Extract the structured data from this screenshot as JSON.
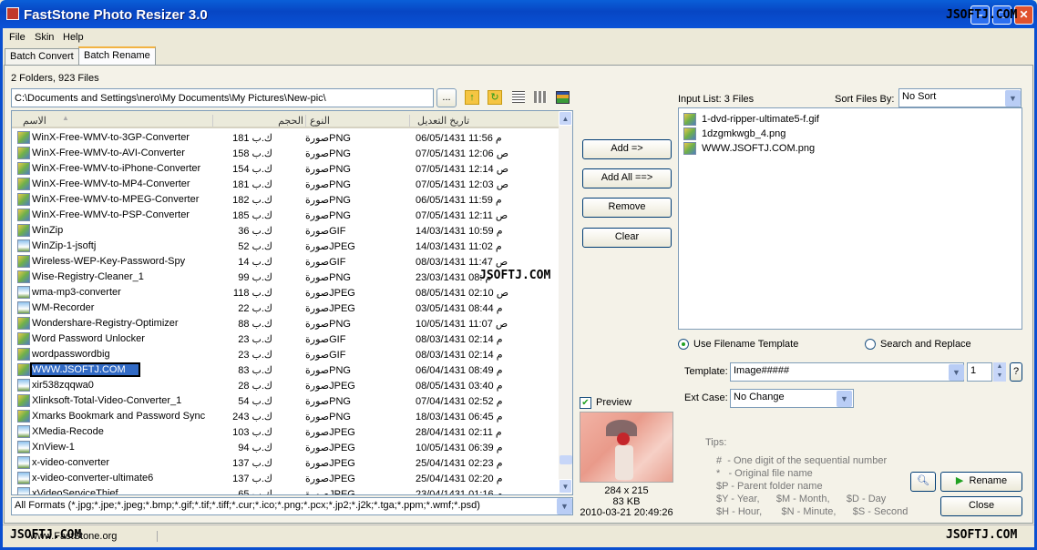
{
  "window": {
    "title": "FastStone Photo Resizer 3.0",
    "watermark": "JSOFTJ.COM",
    "minimize": "–",
    "maximize": "□",
    "close": "✕"
  },
  "menu": [
    "File",
    "Skin",
    "Help"
  ],
  "tabs": [
    {
      "label": "Batch Convert",
      "active": false
    },
    {
      "label": "Batch Rename",
      "active": true
    }
  ],
  "browser": {
    "summary": "2 Folders, 923 Files",
    "path": "C:\\Documents and Settings\\nero\\My Documents\\My Pictures\\New-pic\\",
    "browse_label": "...",
    "columns": {
      "name": "الاسم",
      "size": "الحجم",
      "type": "النوع",
      "modified": "تاريخ التعديل"
    },
    "size_unit": "ك.ب",
    "type_prefix": "صورة",
    "rows": [
      {
        "name": "WinX-Free-WMV-to-3GP-Converter",
        "size": "181",
        "type": "PNG",
        "date": "06/05/1431 11:56",
        "ampm": "م"
      },
      {
        "name": "WinX-Free-WMV-to-AVI-Converter",
        "size": "158",
        "type": "PNG",
        "date": "07/05/1431 12:06",
        "ampm": "ص"
      },
      {
        "name": "WinX-Free-WMV-to-iPhone-Converter",
        "size": "154",
        "type": "PNG",
        "date": "07/05/1431 12:14",
        "ampm": "ص"
      },
      {
        "name": "WinX-Free-WMV-to-MP4-Converter",
        "size": "181",
        "type": "PNG",
        "date": "07/05/1431 12:03",
        "ampm": "ص"
      },
      {
        "name": "WinX-Free-WMV-to-MPEG-Converter",
        "size": "182",
        "type": "PNG",
        "date": "06/05/1431 11:59",
        "ampm": "م"
      },
      {
        "name": "WinX-Free-WMV-to-PSP-Converter",
        "size": "185",
        "type": "PNG",
        "date": "07/05/1431 12:11",
        "ampm": "ص"
      },
      {
        "name": "WinZip",
        "size": "36",
        "type": "GIF",
        "date": "14/03/1431 10:59",
        "ampm": "م"
      },
      {
        "name": "WinZip-1-jsoftj",
        "size": "52",
        "type": "JPEG",
        "date": "14/03/1431 11:02",
        "ampm": "م"
      },
      {
        "name": "Wireless-WEP-Key-Password-Spy",
        "size": "14",
        "type": "GIF",
        "date": "08/03/1431 11:47",
        "ampm": "ص"
      },
      {
        "name": "Wise-Registry-Cleaner_1",
        "size": "99",
        "type": "PNG",
        "date": "23/03/1431 08:",
        "ampm": "م"
      },
      {
        "name": "wma-mp3-converter",
        "size": "118",
        "type": "JPEG",
        "date": "08/05/1431 02:10",
        "ampm": "ص"
      },
      {
        "name": "WM-Recorder",
        "size": "22",
        "type": "JPEG",
        "date": "03/05/1431 08:44",
        "ampm": "م"
      },
      {
        "name": "Wondershare-Registry-Optimizer",
        "size": "88",
        "type": "PNG",
        "date": "10/05/1431 11:07",
        "ampm": "ص"
      },
      {
        "name": "Word Password Unlocker",
        "size": "23",
        "type": "GIF",
        "date": "08/03/1431 02:14",
        "ampm": "م"
      },
      {
        "name": "wordpasswordbig",
        "size": "23",
        "type": "GIF",
        "date": "08/03/1431 02:14",
        "ampm": "م"
      },
      {
        "name": "WWW.JSOFTJ.COM",
        "size": "83",
        "type": "PNG",
        "date": "06/04/1431 08:49",
        "ampm": "م",
        "selected": true
      },
      {
        "name": "xir538zqqwa0",
        "size": "28",
        "type": "JPEG",
        "date": "08/05/1431 03:40",
        "ampm": "م"
      },
      {
        "name": "Xlinksoft-Total-Video-Converter_1",
        "size": "54",
        "type": "PNG",
        "date": "07/04/1431 02:52",
        "ampm": "م"
      },
      {
        "name": "Xmarks Bookmark and Password Sync",
        "size": "243",
        "type": "PNG",
        "date": "18/03/1431 06:45",
        "ampm": "م"
      },
      {
        "name": "XMedia-Recode",
        "size": "103",
        "type": "JPEG",
        "date": "28/04/1431 02:11",
        "ampm": "م"
      },
      {
        "name": "XnView-1",
        "size": "94",
        "type": "JPEG",
        "date": "10/05/1431 06:39",
        "ampm": "م"
      },
      {
        "name": "x-video-converter",
        "size": "137",
        "type": "JPEG",
        "date": "25/04/1431 02:23",
        "ampm": "م"
      },
      {
        "name": "x-video-converter-ultimate6",
        "size": "137",
        "type": "JPEG",
        "date": "25/04/1431 02:20",
        "ampm": "م"
      },
      {
        "name": "xVideoServiceThief",
        "size": "65",
        "type": "JPEG",
        "date": "23/04/1431 01:16",
        "ampm": "م"
      }
    ],
    "filter": "All Formats (*.jpg;*.jpe;*.jpeg;*.bmp;*.gif;*.tif;*.tiff;*.cur;*.ico;*.png;*.pcx;*.jp2;*.j2k;*.tga;*.ppm;*.wmf;*.psd)"
  },
  "actions": {
    "add": "Add =>",
    "add_all": "Add All ==>",
    "remove": "Remove",
    "clear": "Clear"
  },
  "preview": {
    "label": "Preview",
    "checked": true,
    "dimensions": "284 x 215",
    "size": "83 KB",
    "datetime": "2010-03-21 20:49:26"
  },
  "input": {
    "label": "Input List:  3 Files",
    "sort_label": "Sort Files By:",
    "sort_value": "No Sort",
    "files": [
      "1-dvd-ripper-ultimate5-f.gif",
      "1dzgmkwgb_4.png",
      "WWW.JSOFTJ.COM.png"
    ]
  },
  "rename": {
    "mode_template": "Use Filename Template",
    "mode_search": "Search and Replace",
    "selected_mode": "template",
    "template_label": "Template:",
    "template_value": "Image#####",
    "start_number": "1",
    "help": "?",
    "ext_label": "Ext Case:",
    "ext_value": "No Change",
    "tips_title": "Tips:",
    "tips": [
      "#  - One digit of the sequential number",
      "*   - Original file name",
      "$P - Parent folder name",
      "$Y - Year,      $M - Month,      $D - Day",
      "$H - Hour,       $N - Minute,      $S - Second"
    ],
    "rename_button": "Rename",
    "close_button": "Close"
  },
  "status": {
    "website": "www.FastStone.org"
  }
}
